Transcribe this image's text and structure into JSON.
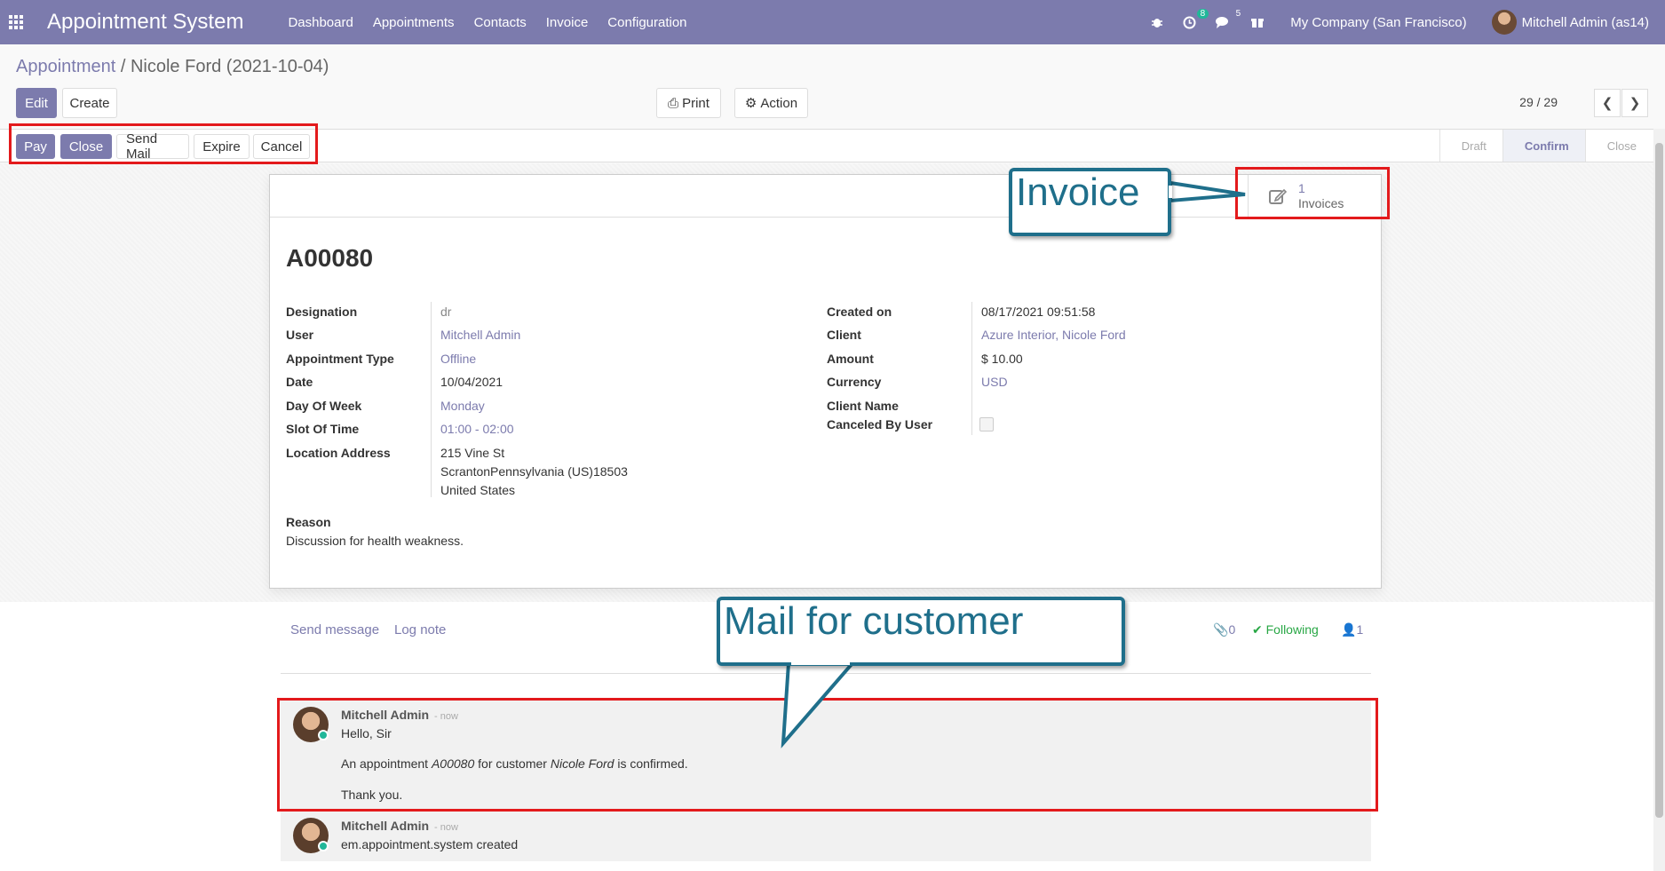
{
  "navbar": {
    "app_title": "Appointment System",
    "menu": [
      "Dashboard",
      "Appointments",
      "Contacts",
      "Invoice",
      "Configuration"
    ],
    "activity_count": "8",
    "message_count": "5",
    "company": "My Company (San Francisco)",
    "user": "Mitchell Admin (as14)"
  },
  "breadcrumb": {
    "parent": "Appointment",
    "separator": " / ",
    "current": "Nicole Ford (2021-10-04)"
  },
  "control": {
    "edit": "Edit",
    "create": "Create",
    "print": "Print",
    "action": "Action",
    "pager": "29 / 29"
  },
  "statusbar": {
    "buttons": [
      "Pay",
      "Close",
      "Send Mail",
      "Expire",
      "Cancel"
    ],
    "stages": [
      "Draft",
      "Confirm",
      "Close"
    ],
    "active_stage": "Confirm"
  },
  "smart_button": {
    "count": "1",
    "label": "Invoices"
  },
  "record": {
    "name": "A00080",
    "left_fields": [
      {
        "label": "Designation",
        "value": "dr"
      },
      {
        "label": "User",
        "value": "Mitchell Admin"
      },
      {
        "label": "Appointment Type",
        "value": "Offline"
      },
      {
        "label": "Date",
        "value": "10/04/2021"
      },
      {
        "label": "Day Of Week",
        "value": "Monday"
      },
      {
        "label": "Slot Of Time",
        "value": "01:00 - 02:00"
      },
      {
        "label": "Location Address",
        "value": "215 Vine St"
      }
    ],
    "address_line2": "ScrantonPennsylvania (US)18503",
    "address_line3": "United States",
    "right_fields": [
      {
        "label": "Created on",
        "value": "08/17/2021 09:51:58"
      },
      {
        "label": "Client",
        "value": "Azure Interior, Nicole Ford"
      },
      {
        "label": "Amount",
        "value": "$ 10.00"
      },
      {
        "label": "Currency",
        "value": "USD"
      },
      {
        "label": "Client Name",
        "value": ""
      },
      {
        "label": "Canceled By User",
        "value": ""
      }
    ],
    "reason_label": "Reason",
    "reason_value": "Discussion for health weakness."
  },
  "chatter": {
    "send_message": "Send message",
    "log_note": "Log note",
    "attachments": "0",
    "following": "Following",
    "followers": "1",
    "messages": [
      {
        "author": "Mitchell Admin",
        "date": "- now",
        "greeting": "Hello, Sir",
        "body_prefix": "An appointment ",
        "body_ref": "A00080",
        "body_mid": " for customer ",
        "body_customer": "Nicole Ford",
        "body_suffix": " is confirmed.",
        "closing": "Thank you."
      },
      {
        "author": "Mitchell Admin",
        "date": "- now",
        "text": "em.appointment.system created"
      }
    ]
  },
  "annotations": {
    "invoice_callout": "Invoice",
    "mail_callout": "Mail for customer"
  },
  "colors": {
    "brand": "#7c7bad",
    "annotation_red": "#e31a1c",
    "callout_blue": "#1f6f8b",
    "following_green": "#28a745"
  }
}
